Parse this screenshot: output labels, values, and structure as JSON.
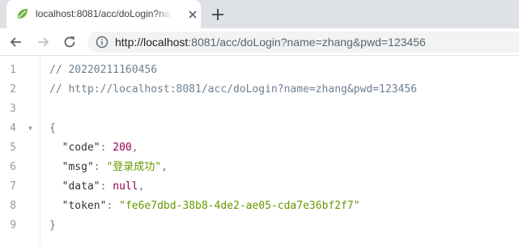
{
  "tab": {
    "title": "localhost:8081/acc/doLogin?name=zhang&pwd=123456",
    "favicon": "leaf-icon",
    "close": "close-icon",
    "new_tab": "plus-icon"
  },
  "toolbar": {
    "url": "http://localhost:8081/acc/doLogin?name=zhang&pwd=123456",
    "url_host": "http://localhost",
    "url_rest": ":8081/acc/doLogin?name=zhang&pwd=123456"
  },
  "viewer": {
    "line_numbers": [
      "1",
      "2",
      "3",
      "4",
      "5",
      "6",
      "7",
      "8",
      "9"
    ],
    "comment_time": "// 20220211160456",
    "comment_url": "// http://localhost:8081/acc/doLogin?name=zhang&pwd=123456",
    "open_brace": "{",
    "close_brace": "}",
    "fields": [
      {
        "key": "\"code\"",
        "value": "200"
      },
      {
        "key": "\"msg\"",
        "value": "\"登录成功\""
      },
      {
        "key": "\"data\"",
        "value": "null"
      },
      {
        "key": "\"token\"",
        "value": "\"fe6e7dbd-38b8-4de2-ae05-cda7e36bf2f7\""
      }
    ]
  },
  "colors": {
    "tabstrip": "#dee1e6",
    "omnibox": "#f1f3f4",
    "number": "#990055",
    "string": "#669900",
    "comment": "#708090"
  }
}
